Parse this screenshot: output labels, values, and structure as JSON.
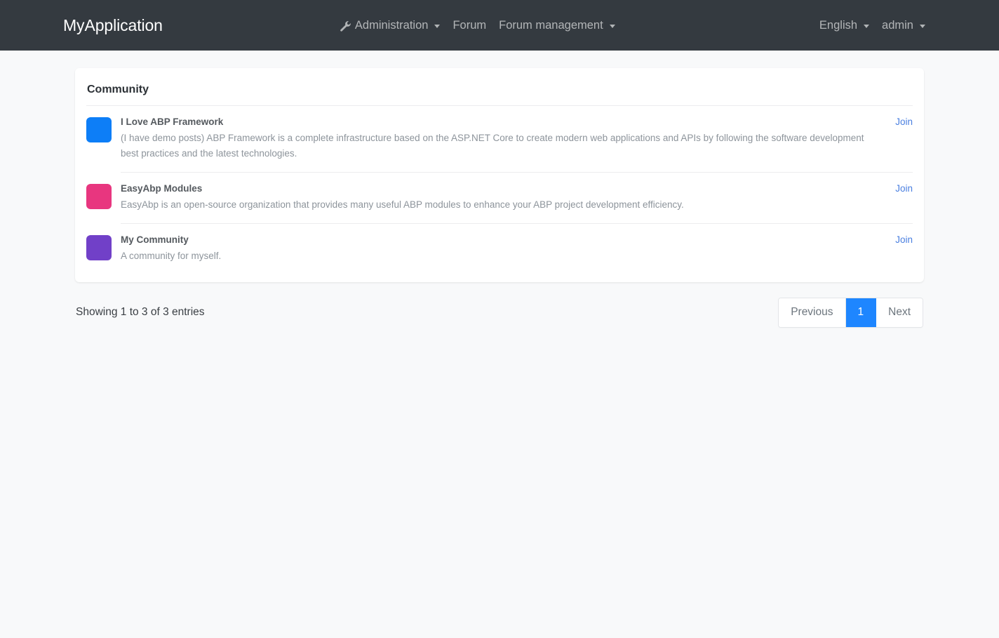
{
  "navbar": {
    "brand": "MyApplication",
    "center_items": [
      {
        "label": "Administration",
        "icon": "wrench-icon",
        "has_caret": true
      },
      {
        "label": "Forum",
        "icon": null,
        "has_caret": false
      },
      {
        "label": "Forum management",
        "icon": null,
        "has_caret": true
      }
    ],
    "right_items": [
      {
        "label": "English",
        "has_caret": true
      },
      {
        "label": "admin",
        "has_caret": true
      }
    ],
    "background_color": "#343a40"
  },
  "card": {
    "title": "Community",
    "communities": [
      {
        "name": "I Love ABP Framework",
        "description": "(I have demo posts) ABP Framework is a complete infrastructure based on the ASP.NET Core to create modern web applications and APIs by following the software development best practices and the latest technologies.",
        "color": "#0d7ef7",
        "action": "Join"
      },
      {
        "name": "EasyAbp Modules",
        "description": "EasyAbp is an open-source organization that provides many useful ABP modules to enhance your ABP project development efficiency.",
        "color": "#e8367f",
        "action": "Join"
      },
      {
        "name": "My Community",
        "description": "A community for myself.",
        "color": "#7140c8",
        "action": "Join"
      }
    ]
  },
  "footer": {
    "entries_info": "Showing 1 to 3 of 3 entries",
    "pagination": {
      "previous_label": "Previous",
      "next_label": "Next",
      "pages": [
        "1"
      ],
      "active_page": "1",
      "active_color": "#1e86ff"
    }
  }
}
